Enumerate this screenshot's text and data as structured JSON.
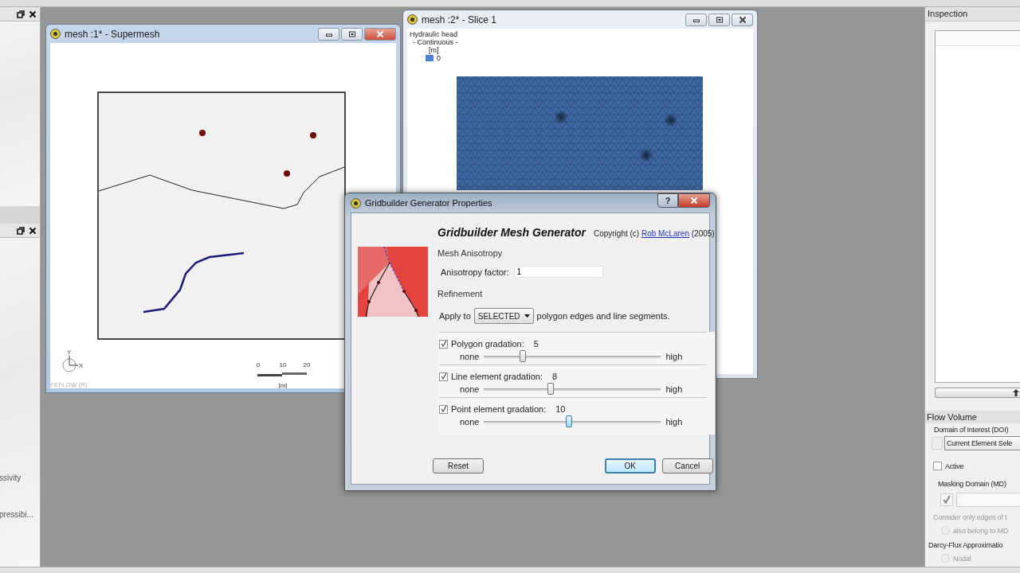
{
  "left_panel": {
    "texts": [
      "ssivity",
      "pressibi..."
    ]
  },
  "windows": [
    {
      "kind": "supermesh",
      "title": "mesh :1* - Supermesh",
      "active": true,
      "axis": {
        "y": "Y",
        "x": "X"
      },
      "scale": {
        "ticks": [
          "0",
          "10",
          "20"
        ],
        "unit": "[m]"
      },
      "watermark": "FEFLOW (R)"
    },
    {
      "kind": "slice",
      "title": "mesh :2* - Slice 1",
      "active": false,
      "legend": {
        "title": "Hydraulic head",
        "mode": "- Continuous -",
        "unit": "[m]",
        "entries": [
          {
            "label": "0",
            "color": "#4a80d8"
          }
        ]
      }
    }
  ],
  "dialog": {
    "title": "Gridbuilder Generator Properties",
    "help": "?",
    "heading": "Gridbuilder Mesh Generator",
    "copyright": {
      "prefix": "Copyright (c)",
      "link": "Rob McLaren",
      "suffix": "(2005)"
    },
    "anisotropy": {
      "group": "Mesh Anisotropy",
      "label": "Anisotropy factor:",
      "value": "1"
    },
    "refinement": {
      "group": "Refinement",
      "prefix": "Apply to",
      "selection": "SELECTED",
      "suffix": "polygon edges and line segments."
    },
    "gradations": [
      {
        "label": "Polygon gradation:",
        "value": "5",
        "checked": true,
        "level": 0.22,
        "focused": false,
        "min_label": "none",
        "max_label": "high"
      },
      {
        "label": "Line element gradation:",
        "value": "8",
        "checked": true,
        "level": 0.375,
        "focused": false,
        "min_label": "none",
        "max_label": "high"
      },
      {
        "label": "Point element gradation:",
        "value": "10",
        "checked": true,
        "level": 0.48,
        "focused": true,
        "min_label": "none",
        "max_label": "high"
      }
    ],
    "buttons": [
      {
        "label": "Reset",
        "default": false
      },
      {
        "label": "OK",
        "default": true
      },
      {
        "label": "Cancel",
        "default": false
      }
    ]
  },
  "inspection_panel": {
    "title": "Inspection",
    "section": "Flow Volume",
    "doi_label": "Domain of Interest (DOI)",
    "doi_radio": {
      "selected": false
    },
    "doi_selection": "Current Element Sele",
    "active": {
      "label": "Active",
      "checked": false
    },
    "masking": {
      "label": "Masking Domain (MD)",
      "checked": true,
      "disabled": true
    },
    "consider_text": "Consider only edges of t",
    "also_option": {
      "label": "also belong to MD",
      "selected": false
    },
    "darcy_label": "Darcy-Flux Approximatio",
    "nodal_option": {
      "label": "Nodal",
      "selected": false
    }
  }
}
